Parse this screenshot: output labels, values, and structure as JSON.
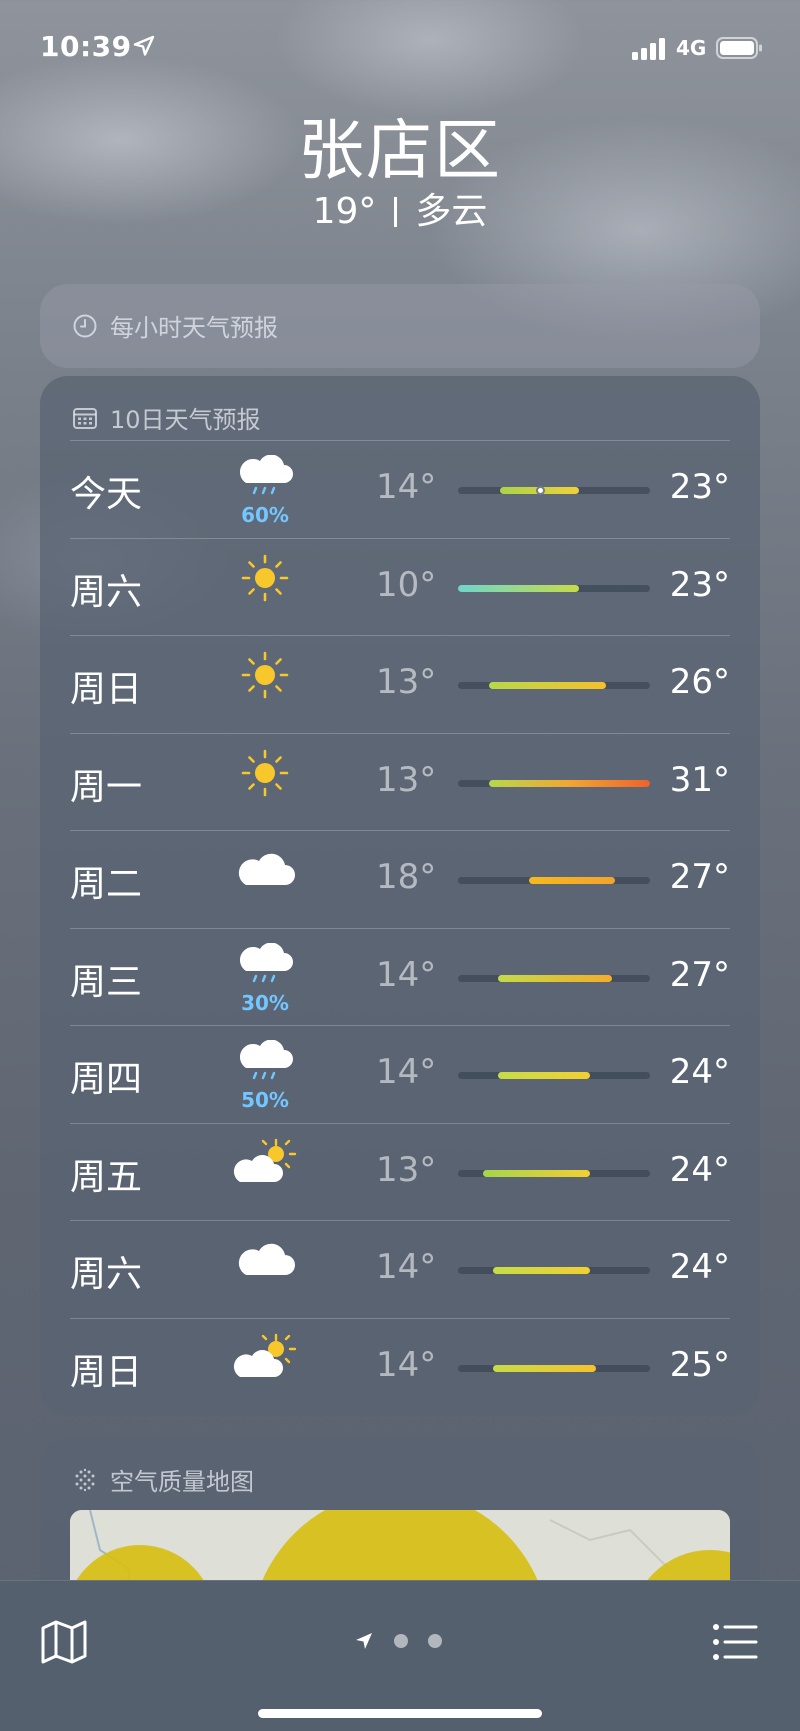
{
  "status": {
    "time": "10:39",
    "network": "4G"
  },
  "header": {
    "city": "张店区",
    "temperature": "19°",
    "condition": "多云"
  },
  "hourly": {
    "title": "每小时天气预报",
    "icon": "clock-icon"
  },
  "daily": {
    "title": "10日天气预报",
    "icon": "calendar-icon",
    "days": [
      {
        "day": "今天",
        "icon": "rain-cloud-icon",
        "precip": "60%",
        "low": "14°",
        "high": "23°",
        "range": [
          0.22,
          0.63
        ],
        "colors": [
          "#a9d34a",
          "#f2d03a"
        ],
        "current": 0.43
      },
      {
        "day": "周六",
        "icon": "sun-icon",
        "precip": "",
        "low": "10°",
        "high": "23°",
        "range": [
          0.0,
          0.63
        ],
        "colors": [
          "#6fd6cc",
          "#c6db48"
        ]
      },
      {
        "day": "周日",
        "icon": "sun-icon",
        "precip": "",
        "low": "13°",
        "high": "26°",
        "range": [
          0.16,
          0.77
        ],
        "colors": [
          "#b6d84a",
          "#f6c02b"
        ]
      },
      {
        "day": "周一",
        "icon": "sun-icon",
        "precip": "",
        "low": "13°",
        "high": "31°",
        "range": [
          0.16,
          1.0
        ],
        "colors": [
          "#b6d84a",
          "#f1a634",
          "#f0622a"
        ]
      },
      {
        "day": "周二",
        "icon": "cloud-icon",
        "precip": "",
        "low": "18°",
        "high": "27°",
        "range": [
          0.37,
          0.82
        ],
        "colors": [
          "#f5b91f",
          "#f3a32c"
        ]
      },
      {
        "day": "周三",
        "icon": "rain-cloud-icon",
        "precip": "30%",
        "low": "14°",
        "high": "27°",
        "range": [
          0.21,
          0.8
        ],
        "colors": [
          "#c3da48",
          "#f4ad2a"
        ]
      },
      {
        "day": "周四",
        "icon": "rain-cloud-icon",
        "precip": "50%",
        "low": "14°",
        "high": "24°",
        "range": [
          0.21,
          0.69
        ],
        "colors": [
          "#c6dc48",
          "#f2cf32"
        ]
      },
      {
        "day": "周五",
        "icon": "partly-sunny-icon",
        "precip": "",
        "low": "13°",
        "high": "24°",
        "range": [
          0.13,
          0.69
        ],
        "colors": [
          "#a6d54a",
          "#f2cf32"
        ]
      },
      {
        "day": "周六",
        "icon": "cloud-icon",
        "precip": "",
        "low": "14°",
        "high": "24°",
        "range": [
          0.18,
          0.69
        ],
        "colors": [
          "#c6dc48",
          "#f2cf32"
        ]
      },
      {
        "day": "周日",
        "icon": "partly-sunny-icon",
        "precip": "",
        "low": "14°",
        "high": "25°",
        "range": [
          0.18,
          0.72
        ],
        "colors": [
          "#c6dc48",
          "#f5c22e"
        ]
      }
    ]
  },
  "air_quality": {
    "title": "空气质量地图",
    "icon": "air-quality-icon"
  },
  "tab_bar": {
    "map_icon": "map-icon",
    "location_icon": "location-arrow-icon",
    "list_icon": "list-icon",
    "page_count": 3
  }
}
